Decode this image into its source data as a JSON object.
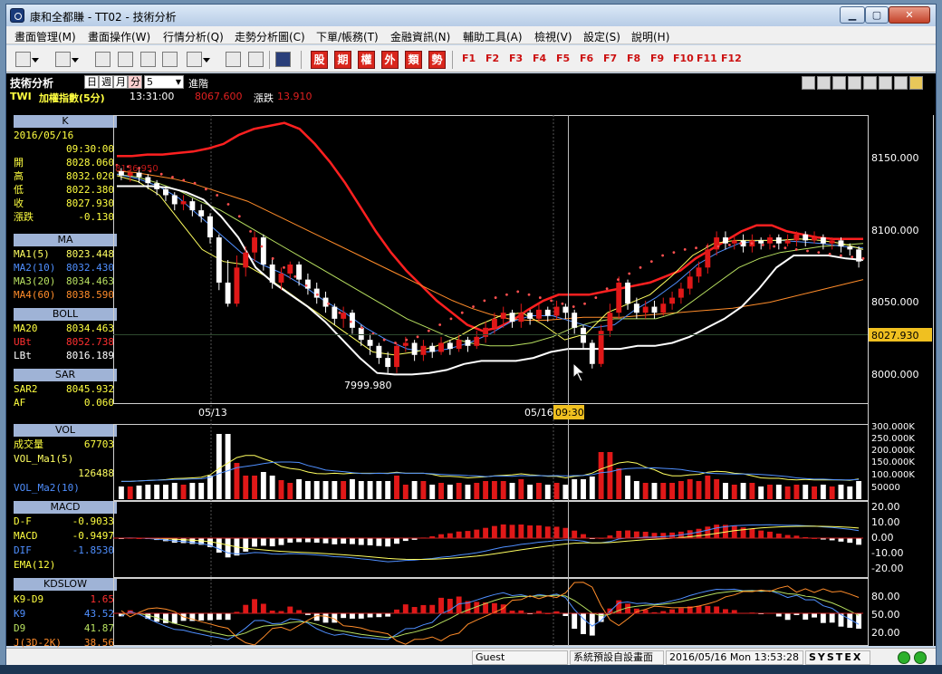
{
  "window": {
    "title": "康和全都賺 - TT02 - 技術分析"
  },
  "window_buttons": {
    "minimize": "▁",
    "maximize": "▢",
    "close": "✕"
  },
  "menu": [
    "畫面管理(M)",
    "畫面操作(W)",
    "行情分析(Q)",
    "走勢分析圖(C)",
    "下單/帳務(T)",
    "金融資訊(N)",
    "輔助工具(A)",
    "檢視(V)",
    "設定(S)",
    "說明(H)"
  ],
  "toolbar": {
    "red_buttons": [
      "股",
      "期",
      "權",
      "外",
      "類",
      "勢"
    ],
    "fkeys": [
      "F1",
      "F2",
      "F3",
      "F4",
      "F5",
      "F6",
      "F7",
      "F8",
      "F9",
      "F10",
      "F11",
      "F12"
    ]
  },
  "chart_header": {
    "panel_title": "技術分析",
    "periods": [
      "日",
      "週",
      "月",
      "分"
    ],
    "minutes_value": "5",
    "advanced_label": "進階",
    "symbol": "TWI",
    "name": "加權指數(5分)",
    "time": "13:31:00",
    "price": "8067.600",
    "change_label": "漲跌",
    "change": "13.910"
  },
  "colors": {
    "up": "#e01818",
    "down": "#ffffff",
    "ma1": "#ffff60",
    "ma2": "#4f8fff",
    "ma3": "#b8e060",
    "ma4": "#ff8c2a",
    "bollinger": "#ff2020",
    "sar": "#ff5050",
    "panel_head": "#9fb3d6"
  },
  "left_panel": {
    "k": {
      "title": "K",
      "date": "2016/05/16",
      "time": "09:30:00",
      "rows": [
        {
          "label": "開",
          "value": "8028.060"
        },
        {
          "label": "高",
          "value": "8032.020"
        },
        {
          "label": "低",
          "value": "8022.380"
        },
        {
          "label": "收",
          "value": "8027.930"
        },
        {
          "label": "漲跌",
          "value": "-0.130"
        }
      ]
    },
    "ma": {
      "title": "MA",
      "rows": [
        {
          "label": "MA1(5)",
          "value": "8023.448"
        },
        {
          "label": "MA2(10)",
          "value": "8032.430"
        },
        {
          "label": "MA3(20)",
          "value": "8034.463"
        },
        {
          "label": "MA4(60)",
          "value": "8038.590"
        }
      ]
    },
    "boll": {
      "title": "BOLL",
      "rows": [
        {
          "label": "MA20",
          "value": "8034.463"
        },
        {
          "label": "UBt",
          "value": "8052.738"
        },
        {
          "label": "LBt",
          "value": "8016.189"
        }
      ]
    },
    "sar": {
      "title": "SAR",
      "rows": [
        {
          "label": "SAR2",
          "value": "8045.932"
        },
        {
          "label": "AF",
          "value": "0.060"
        }
      ]
    },
    "vol": {
      "title": "VOL",
      "rows": [
        {
          "label": "成交量",
          "value": "67703"
        },
        {
          "label": "VOL_Ma1(5)",
          "value": ""
        },
        {
          "label": "",
          "value": "126488"
        },
        {
          "label": "VOL_Ma2(10)",
          "value": ""
        }
      ]
    },
    "macd": {
      "title": "MACD",
      "rows": [
        {
          "label": "D-F",
          "value": "-0.9033"
        },
        {
          "label": "MACD",
          "value": "-0.9497"
        },
        {
          "label": "DIF",
          "value": "-1.8530"
        },
        {
          "label": "EMA(12)",
          "value": ""
        }
      ]
    },
    "kd": {
      "title": "KDSLOW",
      "rows": [
        {
          "label": "K9-D9",
          "value": "1.65"
        },
        {
          "label": "K9",
          "value": "43.52"
        },
        {
          "label": "D9",
          "value": "41.87"
        },
        {
          "label": "J(3D-2K)",
          "value": "38.56"
        }
      ]
    }
  },
  "price_chart": {
    "y_ticks": [
      "8150.000",
      "8100.000",
      "8050.000",
      "8000.000"
    ],
    "current_price_tag": "8027.930",
    "left_value_tag": "8136.950",
    "low_annotation": "7999.980",
    "x_labels": [
      "05/13",
      "05/16"
    ],
    "crosshair_time": "09:30"
  },
  "vol_chart": {
    "y_ticks": [
      "300.000K",
      "250.000K",
      "200.000K",
      "150.000K",
      "100.000K",
      "50000"
    ]
  },
  "macd_chart": {
    "y_ticks": [
      "20.00",
      "10.00",
      "0.00",
      "-10.00",
      "-20.00"
    ]
  },
  "kd_chart": {
    "y_ticks": [
      "80.00",
      "50.00",
      "20.00"
    ]
  },
  "chart_data": {
    "type": "candlestick",
    "title": "加權指數(5分)",
    "ylim": [
      7980,
      8170
    ],
    "candles": [
      {
        "o": 8134,
        "c": 8131,
        "h": 8136,
        "l": 8128
      },
      {
        "o": 8131,
        "c": 8133,
        "h": 8135,
        "l": 8127
      },
      {
        "o": 8133,
        "c": 8130,
        "h": 8135,
        "l": 8126
      },
      {
        "o": 8130,
        "c": 8126,
        "h": 8132,
        "l": 8122
      },
      {
        "o": 8126,
        "c": 8122,
        "h": 8128,
        "l": 8118
      },
      {
        "o": 8122,
        "c": 8118,
        "h": 8124,
        "l": 8114
      },
      {
        "o": 8118,
        "c": 8112,
        "h": 8120,
        "l": 8108
      },
      {
        "o": 8112,
        "c": 8114,
        "h": 8118,
        "l": 8108
      },
      {
        "o": 8114,
        "c": 8108,
        "h": 8116,
        "l": 8104
      },
      {
        "o": 8108,
        "c": 8104,
        "h": 8112,
        "l": 8100
      },
      {
        "o": 8104,
        "c": 8090,
        "h": 8106,
        "l": 8086
      },
      {
        "o": 8090,
        "c": 8060,
        "h": 8092,
        "l": 8055
      },
      {
        "o": 8060,
        "c": 8046,
        "h": 8075,
        "l": 8044
      },
      {
        "o": 8046,
        "c": 8070,
        "h": 8078,
        "l": 8044
      },
      {
        "o": 8070,
        "c": 8080,
        "h": 8084,
        "l": 8064
      },
      {
        "o": 8080,
        "c": 8090,
        "h": 8094,
        "l": 8074
      },
      {
        "o": 8090,
        "c": 8072,
        "h": 8092,
        "l": 8068
      },
      {
        "o": 8072,
        "c": 8060,
        "h": 8076,
        "l": 8056
      },
      {
        "o": 8060,
        "c": 8066,
        "h": 8070,
        "l": 8055
      },
      {
        "o": 8066,
        "c": 8072,
        "h": 8074,
        "l": 8062
      },
      {
        "o": 8072,
        "c": 8062,
        "h": 8074,
        "l": 8058
      },
      {
        "o": 8062,
        "c": 8056,
        "h": 8066,
        "l": 8052
      },
      {
        "o": 8056,
        "c": 8050,
        "h": 8060,
        "l": 8046
      },
      {
        "o": 8050,
        "c": 8044,
        "h": 8054,
        "l": 8040
      },
      {
        "o": 8044,
        "c": 8036,
        "h": 8046,
        "l": 8032
      },
      {
        "o": 8036,
        "c": 8040,
        "h": 8044,
        "l": 8030
      },
      {
        "o": 8040,
        "c": 8030,
        "h": 8042,
        "l": 8026
      },
      {
        "o": 8030,
        "c": 8022,
        "h": 8032,
        "l": 8018
      },
      {
        "o": 8022,
        "c": 8018,
        "h": 8026,
        "l": 8012
      },
      {
        "o": 8018,
        "c": 8010,
        "h": 8020,
        "l": 8006
      },
      {
        "o": 8010,
        "c": 8004,
        "h": 8014,
        "l": 8000
      },
      {
        "o": 8004,
        "c": 8018,
        "h": 8020,
        "l": 8000
      },
      {
        "o": 8018,
        "c": 8020,
        "h": 8024,
        "l": 8014
      },
      {
        "o": 8020,
        "c": 8012,
        "h": 8022,
        "l": 8008
      },
      {
        "o": 8012,
        "c": 8018,
        "h": 8022,
        "l": 8008
      },
      {
        "o": 8018,
        "c": 8014,
        "h": 8020,
        "l": 8010
      },
      {
        "o": 8014,
        "c": 8020,
        "h": 8024,
        "l": 8012
      },
      {
        "o": 8020,
        "c": 8016,
        "h": 8022,
        "l": 8012
      },
      {
        "o": 8016,
        "c": 8022,
        "h": 8026,
        "l": 8014
      },
      {
        "o": 8022,
        "c": 8018,
        "h": 8024,
        "l": 8014
      },
      {
        "o": 8018,
        "c": 8024,
        "h": 8028,
        "l": 8016
      },
      {
        "o": 8024,
        "c": 8030,
        "h": 8034,
        "l": 8020
      },
      {
        "o": 8030,
        "c": 8036,
        "h": 8040,
        "l": 8026
      },
      {
        "o": 8036,
        "c": 8040,
        "h": 8044,
        "l": 8030
      },
      {
        "o": 8040,
        "c": 8034,
        "h": 8042,
        "l": 8030
      },
      {
        "o": 8034,
        "c": 8040,
        "h": 8046,
        "l": 8030
      },
      {
        "o": 8040,
        "c": 8036,
        "h": 8042,
        "l": 8032
      },
      {
        "o": 8036,
        "c": 8042,
        "h": 8046,
        "l": 8034
      },
      {
        "o": 8042,
        "c": 8038,
        "h": 8044,
        "l": 8034
      },
      {
        "o": 8038,
        "c": 8044,
        "h": 8048,
        "l": 8036
      },
      {
        "o": 8044,
        "c": 8040,
        "h": 8046,
        "l": 8036
      },
      {
        "o": 8040,
        "c": 8030,
        "h": 8042,
        "l": 8026
      },
      {
        "o": 8030,
        "c": 8020,
        "h": 8032,
        "l": 8016
      },
      {
        "o": 8020,
        "c": 8006,
        "h": 8022,
        "l": 8003
      },
      {
        "o": 8006,
        "c": 8028,
        "h": 8032,
        "l": 8004
      },
      {
        "o": 8028,
        "c": 8040,
        "h": 8046,
        "l": 8024
      },
      {
        "o": 8040,
        "c": 8060,
        "h": 8064,
        "l": 8036
      },
      {
        "o": 8060,
        "c": 8046,
        "h": 8062,
        "l": 8042
      },
      {
        "o": 8046,
        "c": 8040,
        "h": 8050,
        "l": 8036
      },
      {
        "o": 8040,
        "c": 8044,
        "h": 8048,
        "l": 8036
      },
      {
        "o": 8044,
        "c": 8040,
        "h": 8048,
        "l": 8036
      },
      {
        "o": 8040,
        "c": 8046,
        "h": 8050,
        "l": 8038
      },
      {
        "o": 8046,
        "c": 8050,
        "h": 8054,
        "l": 8042
      },
      {
        "o": 8050,
        "c": 8056,
        "h": 8060,
        "l": 8046
      },
      {
        "o": 8056,
        "c": 8064,
        "h": 8068,
        "l": 8052
      },
      {
        "o": 8064,
        "c": 8070,
        "h": 8074,
        "l": 8060
      },
      {
        "o": 8070,
        "c": 8082,
        "h": 8086,
        "l": 8066
      },
      {
        "o": 8082,
        "c": 8090,
        "h": 8094,
        "l": 8078
      },
      {
        "o": 8090,
        "c": 8086,
        "h": 8094,
        "l": 8082
      },
      {
        "o": 8086,
        "c": 8088,
        "h": 8092,
        "l": 8082
      },
      {
        "o": 8088,
        "c": 8084,
        "h": 8092,
        "l": 8080
      },
      {
        "o": 8084,
        "c": 8088,
        "h": 8092,
        "l": 8080
      },
      {
        "o": 8088,
        "c": 8086,
        "h": 8090,
        "l": 8082
      },
      {
        "o": 8086,
        "c": 8090,
        "h": 8092,
        "l": 8082
      },
      {
        "o": 8090,
        "c": 8086,
        "h": 8092,
        "l": 8082
      },
      {
        "o": 8086,
        "c": 8088,
        "h": 8092,
        "l": 8084
      },
      {
        "o": 8088,
        "c": 8092,
        "h": 8094,
        "l": 8084
      },
      {
        "o": 8092,
        "c": 8088,
        "h": 8094,
        "l": 8084
      },
      {
        "o": 8088,
        "c": 8090,
        "h": 8094,
        "l": 8086
      },
      {
        "o": 8090,
        "c": 8086,
        "h": 8092,
        "l": 8082
      },
      {
        "o": 8086,
        "c": 8088,
        "h": 8090,
        "l": 8082
      },
      {
        "o": 8088,
        "c": 8084,
        "h": 8090,
        "l": 8080
      },
      {
        "o": 8084,
        "c": 8082,
        "h": 8086,
        "l": 8078
      },
      {
        "o": 8082,
        "c": 8074,
        "h": 8084,
        "l": 8070
      }
    ],
    "overlays": [
      {
        "name": "UBt",
        "color": "#ff2020",
        "width": 2.5,
        "values": [
          8144,
          8144,
          8145,
          8145,
          8146,
          8147,
          8149,
          8152,
          8158,
          8162,
          8164,
          8166,
          8162,
          8152,
          8140,
          8126,
          8110,
          8094,
          8080,
          8068,
          8058,
          8048,
          8040,
          8032,
          8028,
          8030,
          8035,
          8042,
          8048,
          8052,
          8052,
          8052,
          8054,
          8056,
          8058,
          8060,
          8064,
          8068,
          8076,
          8082,
          8088,
          8094,
          8098,
          8098,
          8094,
          8092,
          8090,
          8089,
          8089,
          8089
        ]
      },
      {
        "name": "MA4(60)",
        "color": "#ff8c2a",
        "width": 1,
        "values": [
          8134,
          8133,
          8131,
          8129,
          8126,
          8122,
          8118,
          8114,
          8108,
          8102,
          8096,
          8090,
          8084,
          8078,
          8072,
          8066,
          8060,
          8054,
          8048,
          8043,
          8039,
          8036,
          8035,
          8035,
          8036,
          8037,
          8037,
          8037,
          8038,
          8039,
          8040,
          8041,
          8042,
          8043,
          8045,
          8047,
          8050,
          8053,
          8056,
          8059,
          8062
        ]
      },
      {
        "name": "MA3(20)",
        "color": "#b8e060",
        "width": 1,
        "values": [
          8132,
          8130,
          8126,
          8121,
          8114,
          8108,
          8100,
          8092,
          8084,
          8076,
          8068,
          8060,
          8052,
          8044,
          8036,
          8030,
          8024,
          8020,
          8018,
          8018,
          8020,
          8024,
          8030,
          8034,
          8036,
          8036,
          8036,
          8040,
          8050,
          8060,
          8070,
          8076,
          8080,
          8082,
          8084,
          8085,
          8086
        ]
      },
      {
        "name": "MA2(10)",
        "color": "#4f8fff",
        "width": 1,
        "values": [
          8132,
          8129,
          8124,
          8116,
          8104,
          8092,
          8080,
          8072,
          8066,
          8058,
          8048,
          8040,
          8030,
          8022,
          8016,
          8014,
          8016,
          8020,
          8026,
          8034,
          8038,
          8038,
          8034,
          8030,
          8032,
          8042,
          8050,
          8060,
          8072,
          8080,
          8086,
          8088,
          8088,
          8087,
          8086,
          8084,
          8083
        ]
      },
      {
        "name": "MA1(5)",
        "color": "#ffff60",
        "width": 1,
        "values": [
          8131,
          8127,
          8118,
          8100,
          8082,
          8074,
          8072,
          8064,
          8054,
          8044,
          8034,
          8024,
          8014,
          8012,
          8014,
          8018,
          8024,
          8032,
          8038,
          8040,
          8032,
          8022,
          8026,
          8040,
          8046,
          8052,
          8064,
          8078,
          8086,
          8088,
          8088,
          8088,
          8089,
          8088,
          8086,
          8082
        ]
      },
      {
        "name": "LBt",
        "color": "#ffffff",
        "width": 2,
        "values": [
          8124,
          8124,
          8124,
          8123,
          8120,
          8115,
          8104,
          8090,
          8070,
          8060,
          8052,
          8044,
          8034,
          8022,
          8010,
          8000,
          7999,
          7999,
          8000,
          8002,
          8006,
          8008,
          8008,
          8008,
          8010,
          8014,
          8016,
          8016,
          8016,
          8016,
          8018,
          8018,
          8020,
          8024,
          8030,
          8036,
          8044,
          8056,
          8070,
          8078,
          8078,
          8078,
          8076,
          8075
        ]
      }
    ],
    "sar": [
      8138,
      8137,
      8136,
      8134,
      8132,
      8130,
      8128,
      8126,
      8122,
      8118,
      8112,
      8104,
      8094,
      8084,
      8076,
      8070,
      8064,
      8058,
      8052,
      8046,
      8040,
      8034,
      8030,
      8026,
      8022,
      8020,
      8022,
      8024,
      8028,
      8032,
      8036,
      8040,
      8044,
      8048,
      8050,
      8052,
      8054,
      8052,
      8050,
      8048,
      8046,
      8044,
      8046,
      8050,
      8056,
      8062,
      8066,
      8070,
      8074,
      8078,
      8080,
      8082,
      8083,
      8084,
      8084,
      8085,
      8086,
      8086,
      8085,
      8084,
      8083,
      8082,
      8081,
      8080,
      8079,
      8078,
      8077,
      8076
    ]
  }
}
